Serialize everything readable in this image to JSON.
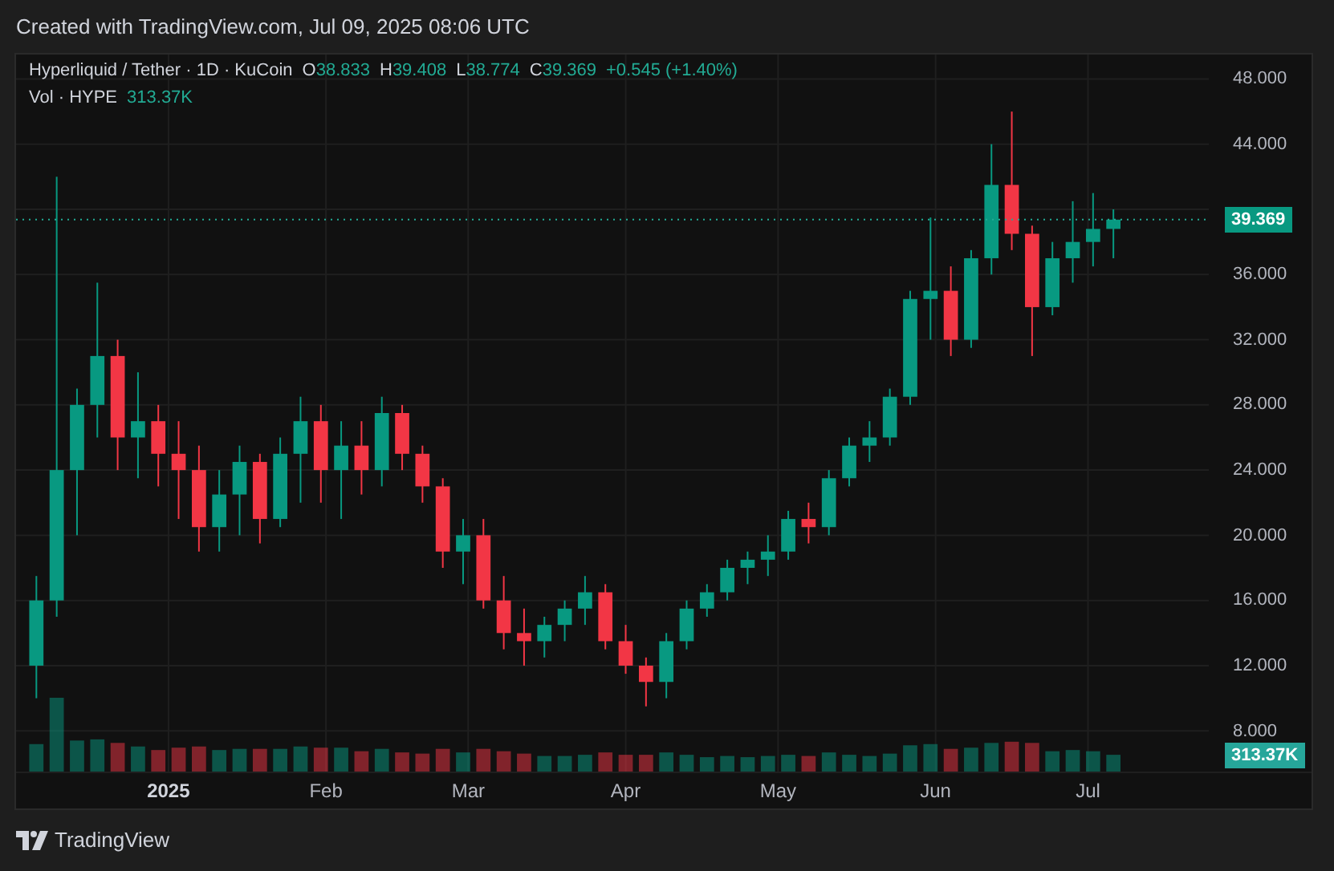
{
  "header": {
    "text": "Created with TradingView.com, Jul 09, 2025 08:06 UTC"
  },
  "legend": {
    "symbol": "Hyperliquid / Tether · 1D · KuCoin",
    "ohlc": [
      {
        "label": "O",
        "value": "38.833"
      },
      {
        "label": "H",
        "value": "39.408"
      },
      {
        "label": "L",
        "value": "38.774"
      },
      {
        "label": "C",
        "value": "39.369"
      }
    ],
    "change": "+0.545 (+1.40%)",
    "volume_label": "Vol · HYPE",
    "volume_value": "313.37K"
  },
  "chart": {
    "chart_data": {
      "type": "candlestick",
      "x": [
        "2024-12-06",
        "2024-12-10",
        "2024-12-14",
        "2024-12-18",
        "2024-12-22",
        "2024-12-26",
        "2024-12-30",
        "2025-01-03",
        "2025-01-07",
        "2025-01-11",
        "2025-01-15",
        "2025-01-19",
        "2025-01-23",
        "2025-01-27",
        "2025-01-31",
        "2025-02-04",
        "2025-02-08",
        "2025-02-12",
        "2025-02-16",
        "2025-02-20",
        "2025-02-24",
        "2025-02-28",
        "2025-03-04",
        "2025-03-08",
        "2025-03-12",
        "2025-03-16",
        "2025-03-20",
        "2025-03-24",
        "2025-03-28",
        "2025-04-01",
        "2025-04-05",
        "2025-04-09",
        "2025-04-13",
        "2025-04-17",
        "2025-04-21",
        "2025-04-25",
        "2025-04-29",
        "2025-05-03",
        "2025-05-07",
        "2025-05-11",
        "2025-05-15",
        "2025-05-19",
        "2025-05-23",
        "2025-05-27",
        "2025-05-31",
        "2025-06-04",
        "2025-06-08",
        "2025-06-12",
        "2025-06-16",
        "2025-06-20",
        "2025-06-24",
        "2025-06-28",
        "2025-07-02",
        "2025-07-06"
      ],
      "ohlc": [
        [
          12,
          17.5,
          10,
          16
        ],
        [
          16,
          42,
          15,
          24
        ],
        [
          24,
          29,
          20,
          28
        ],
        [
          28,
          35.5,
          26,
          31
        ],
        [
          31,
          32,
          24,
          26
        ],
        [
          26,
          30,
          23.5,
          27
        ],
        [
          27,
          28,
          23,
          25
        ],
        [
          25,
          27,
          21,
          24
        ],
        [
          24,
          25.5,
          19,
          20.5
        ],
        [
          20.5,
          24,
          19,
          22.5
        ],
        [
          22.5,
          25.5,
          20,
          24.5
        ],
        [
          24.5,
          25,
          19.5,
          21
        ],
        [
          21,
          26,
          20.5,
          25
        ],
        [
          25,
          28.5,
          22,
          27
        ],
        [
          27,
          28,
          22,
          24
        ],
        [
          24,
          27,
          21,
          25.5
        ],
        [
          25.5,
          27,
          22.5,
          24
        ],
        [
          24,
          28.5,
          23,
          27.5
        ],
        [
          27.5,
          28,
          24,
          25
        ],
        [
          25,
          25.5,
          22,
          23
        ],
        [
          23,
          23.5,
          18,
          19
        ],
        [
          19,
          21,
          17,
          20
        ],
        [
          20,
          21,
          15.5,
          16
        ],
        [
          16,
          17.5,
          13,
          14
        ],
        [
          14,
          15.5,
          12,
          13.5
        ],
        [
          13.5,
          15,
          12.5,
          14.5
        ],
        [
          14.5,
          16,
          13.5,
          15.5
        ],
        [
          15.5,
          17.5,
          14.5,
          16.5
        ],
        [
          16.5,
          17,
          13,
          13.5
        ],
        [
          13.5,
          14.5,
          11.5,
          12
        ],
        [
          12,
          12.5,
          9.5,
          11
        ],
        [
          11,
          14,
          10,
          13.5
        ],
        [
          13.5,
          16,
          13,
          15.5
        ],
        [
          15.5,
          17,
          15,
          16.5
        ],
        [
          16.5,
          18.5,
          16,
          18
        ],
        [
          18,
          19,
          17,
          18.5
        ],
        [
          18.5,
          20,
          17.5,
          19
        ],
        [
          19,
          21.5,
          18.5,
          21
        ],
        [
          21,
          22,
          19.5,
          20.5
        ],
        [
          20.5,
          24,
          20,
          23.5
        ],
        [
          23.5,
          26,
          23,
          25.5
        ],
        [
          25.5,
          27,
          24.5,
          26
        ],
        [
          26,
          29,
          25.5,
          28.5
        ],
        [
          28.5,
          35,
          28,
          34.5
        ],
        [
          34.5,
          39.5,
          32,
          35
        ],
        [
          35,
          36.5,
          31,
          32
        ],
        [
          32,
          37.5,
          31.5,
          37
        ],
        [
          37,
          44,
          36,
          41.5
        ],
        [
          41.5,
          46,
          37.5,
          38.5
        ],
        [
          38.5,
          39,
          31,
          34
        ],
        [
          34,
          38,
          33.5,
          37
        ],
        [
          37,
          40.5,
          35.5,
          38
        ],
        [
          38,
          41,
          36.5,
          38.8
        ],
        [
          38.8,
          40,
          37,
          39.369
        ]
      ],
      "xlim": [
        "2024-12-02",
        "2025-08-14"
      ],
      "ylim": [
        5.5,
        49.5
      ],
      "grid": true,
      "ref_lines": [
        {
          "axis": "y",
          "value": 39.369,
          "color": "#22ab94"
        }
      ],
      "xticks": [
        {
          "value": "2025-01-01",
          "label": "2025"
        },
        {
          "value": "2025-02-01",
          "label": "Feb"
        },
        {
          "value": "2025-03-01",
          "label": "Mar"
        },
        {
          "value": "2025-04-01",
          "label": "Apr"
        },
        {
          "value": "2025-05-01",
          "label": "May"
        },
        {
          "value": "2025-06-01",
          "label": "Jun"
        },
        {
          "value": "2025-07-01",
          "label": "Jul"
        }
      ],
      "yticks": [
        {
          "value": 48,
          "label": "48.000"
        },
        {
          "value": 44,
          "label": "44.000"
        },
        {
          "value": 36,
          "label": "36.000"
        },
        {
          "value": 32,
          "label": "32.000"
        },
        {
          "value": 28,
          "label": "28.000"
        },
        {
          "value": 24,
          "label": "24.000"
        },
        {
          "value": 20,
          "label": "20.000"
        },
        {
          "value": 16,
          "label": "16.000"
        },
        {
          "value": 12,
          "label": "12.000"
        },
        {
          "value": 8,
          "label": "8.000"
        }
      ]
    }
  },
  "price_axis": {
    "last_price": "39.369",
    "last_volume": "313.37K"
  },
  "footer": {
    "brand": "TradingView"
  }
}
